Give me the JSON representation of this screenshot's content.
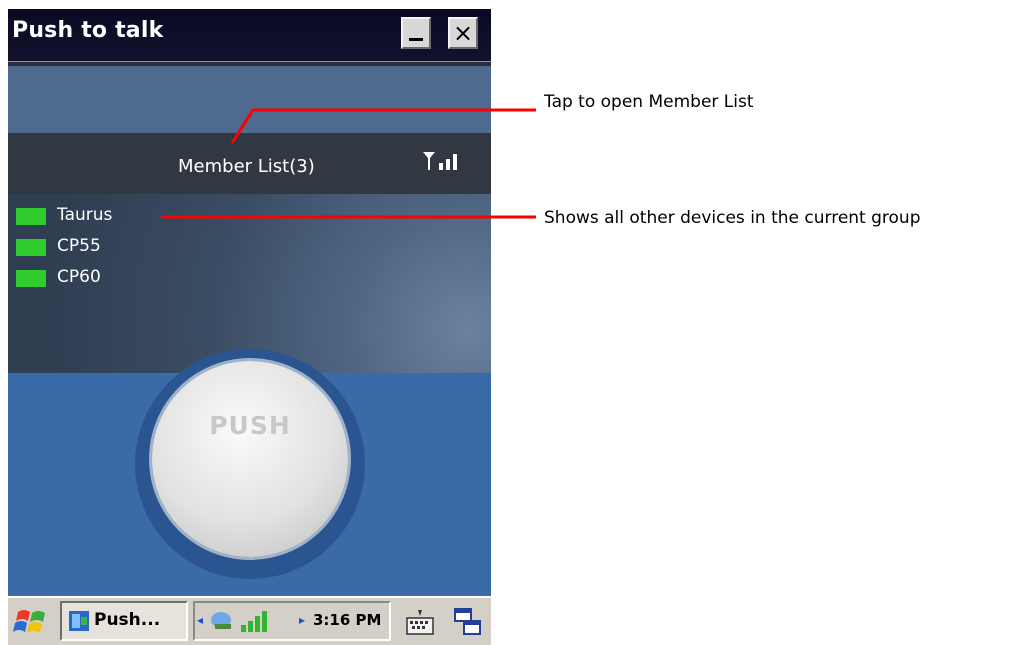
{
  "window": {
    "title": "Push to talk",
    "minimize_icon": "minimize-icon",
    "close_icon": "close-icon",
    "close_glyph": "×"
  },
  "member_list": {
    "title": "Member List(3)",
    "signal_icon": "signal-strength-icon",
    "status_color": "#2ecc2e",
    "members": [
      {
        "name": "Taurus"
      },
      {
        "name": "CP55"
      },
      {
        "name": "CP60"
      }
    ]
  },
  "push_button": {
    "label": "PUSH"
  },
  "taskbar": {
    "start_icon": "windows-start-icon",
    "task_label": "Push...",
    "tray_left_arrow": "◂",
    "tray_right_arrow": "▸",
    "network_icon": "network-icon",
    "signal_icon": "cellular-signal-icon",
    "clock": "3:16 PM",
    "keyboard_icon": "keyboard-icon",
    "switcher_icon": "window-switcher-icon"
  },
  "annotations": [
    {
      "text": "Tap to open Member List"
    },
    {
      "text": "Shows all other devices in the current group"
    }
  ],
  "colors": {
    "annotation_line": "#ff0000",
    "title_bar": "#0a0a24",
    "member_header": "#323842",
    "app_background": "#3a6aa7"
  }
}
